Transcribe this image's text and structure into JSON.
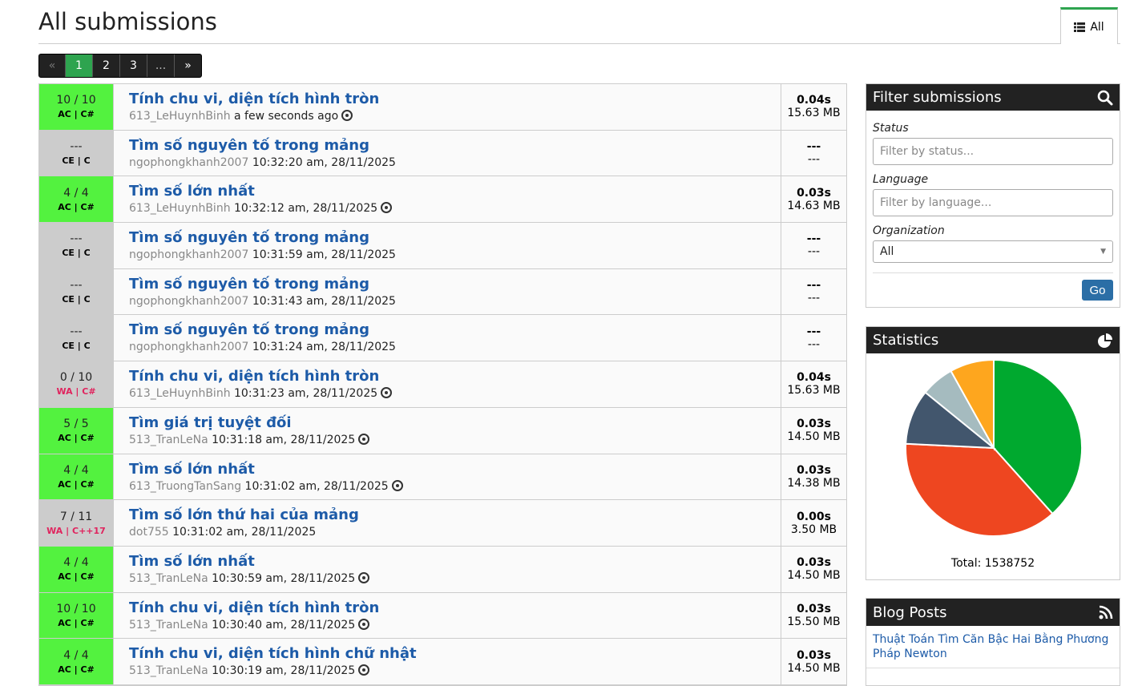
{
  "page": {
    "title": "All submissions",
    "tab_label": "All"
  },
  "pager": {
    "prev": "«",
    "pages": [
      "1",
      "2",
      "3",
      "..."
    ],
    "next": "»",
    "active": "1"
  },
  "submissions": [
    {
      "points": "10 / 10",
      "status": "AC | C#",
      "type": "ac",
      "problem": "Tính chu vi, diện tích hình tròn",
      "user": "613_LeHuynhBinh",
      "time": "a few seconds ago",
      "eye": true,
      "exec": "0.04s",
      "mem": "15.63 MB"
    },
    {
      "points": "---",
      "status": "CE | C",
      "type": "ce",
      "problem": "Tìm số nguyên tố trong mảng",
      "user": "ngophongkhanh2007",
      "time": "10:32:20 am, 28/11/2025",
      "eye": false,
      "exec": "---",
      "mem": "---"
    },
    {
      "points": "4 / 4",
      "status": "AC | C#",
      "type": "ac",
      "problem": "Tìm số lớn nhất",
      "user": "613_LeHuynhBinh",
      "time": "10:32:12 am, 28/11/2025",
      "eye": true,
      "exec": "0.03s",
      "mem": "14.63 MB"
    },
    {
      "points": "---",
      "status": "CE | C",
      "type": "ce",
      "problem": "Tìm số nguyên tố trong mảng",
      "user": "ngophongkhanh2007",
      "time": "10:31:59 am, 28/11/2025",
      "eye": false,
      "exec": "---",
      "mem": "---"
    },
    {
      "points": "---",
      "status": "CE | C",
      "type": "ce",
      "problem": "Tìm số nguyên tố trong mảng",
      "user": "ngophongkhanh2007",
      "time": "10:31:43 am, 28/11/2025",
      "eye": false,
      "exec": "---",
      "mem": "---"
    },
    {
      "points": "---",
      "status": "CE | C",
      "type": "ce",
      "problem": "Tìm số nguyên tố trong mảng",
      "user": "ngophongkhanh2007",
      "time": "10:31:24 am, 28/11/2025",
      "eye": false,
      "exec": "---",
      "mem": "---"
    },
    {
      "points": "0 / 10",
      "status": "WA | C#",
      "type": "wa",
      "problem": "Tính chu vi, diện tích hình tròn",
      "user": "613_LeHuynhBinh",
      "time": "10:31:23 am, 28/11/2025",
      "eye": true,
      "exec": "0.04s",
      "mem": "15.63 MB"
    },
    {
      "points": "5 / 5",
      "status": "AC | C#",
      "type": "ac",
      "problem": "Tìm giá trị tuyệt đối",
      "user": "513_TranLeNa",
      "time": "10:31:18 am, 28/11/2025",
      "eye": true,
      "exec": "0.03s",
      "mem": "14.50 MB"
    },
    {
      "points": "4 / 4",
      "status": "AC | C#",
      "type": "ac",
      "problem": "Tìm số lớn nhất",
      "user": "613_TruongTanSang",
      "time": "10:31:02 am, 28/11/2025",
      "eye": true,
      "exec": "0.03s",
      "mem": "14.38 MB"
    },
    {
      "points": "7 / 11",
      "status": "WA | C++17",
      "type": "wa",
      "problem": "Tìm số lớn thứ hai của mảng",
      "user": "dot755",
      "time": "10:31:02 am, 28/11/2025",
      "eye": false,
      "exec": "0.00s",
      "mem": "3.50 MB"
    },
    {
      "points": "4 / 4",
      "status": "AC | C#",
      "type": "ac",
      "problem": "Tìm số lớn nhất",
      "user": "513_TranLeNa",
      "time": "10:30:59 am, 28/11/2025",
      "eye": true,
      "exec": "0.03s",
      "mem": "14.50 MB"
    },
    {
      "points": "10 / 10",
      "status": "AC | C#",
      "type": "ac",
      "problem": "Tính chu vi, diện tích hình tròn",
      "user": "513_TranLeNa",
      "time": "10:30:40 am, 28/11/2025",
      "eye": true,
      "exec": "0.03s",
      "mem": "15.50 MB"
    },
    {
      "points": "4 / 4",
      "status": "AC | C#",
      "type": "ac",
      "problem": "Tính chu vi, diện tích hình chữ nhật",
      "user": "513_TranLeNa",
      "time": "10:30:19 am, 28/11/2025",
      "eye": true,
      "exec": "0.03s",
      "mem": "14.50 MB"
    }
  ],
  "filter": {
    "title": "Filter submissions",
    "status_label": "Status",
    "status_placeholder": "Filter by status...",
    "language_label": "Language",
    "language_placeholder": "Filter by language...",
    "org_label": "Organization",
    "org_value": "All",
    "go_label": "Go"
  },
  "stats": {
    "title": "Statistics",
    "total": "Total: 1538752",
    "slices": [
      {
        "value": 38,
        "color": "#00a92f"
      },
      {
        "value": 37,
        "color": "#ee4620"
      },
      {
        "value": 10,
        "color": "#42566d"
      },
      {
        "value": 6,
        "color": "#a5bbbf"
      },
      {
        "value": 8,
        "color": "#fea61e"
      }
    ]
  },
  "blog": {
    "title": "Blog Posts",
    "posts": [
      "Thuật Toán Tìm Căn Bậc Hai Bằng Phương Pháp Newton"
    ]
  }
}
